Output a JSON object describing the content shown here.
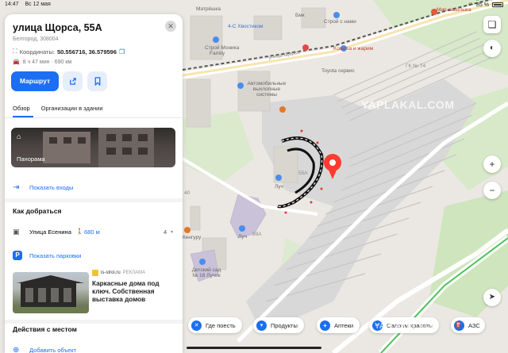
{
  "status": {
    "time": "14:47",
    "date": "Вс 12 мая",
    "battery": "85 %"
  },
  "card": {
    "title": "улица Щорса, 55А",
    "subtitle": "Белгород, 308004",
    "coords_label": "Координаты:",
    "coords_value": "50.556716, 36.579596",
    "route_info": "8 ч 47 мин · 690 км",
    "route_button": "Маршрут",
    "tabs": [
      "Обзор",
      "Организации в здании"
    ],
    "panorama_label": "Панорама",
    "show_entrances": "Показать входы",
    "how_to_get": "Как добраться",
    "street": "Улица Есенина",
    "street_distance": "680 м",
    "street_count": "4",
    "show_parking": "Показать парковки",
    "ad_source": "is-stroi.ru",
    "ad_tag": "РЕКЛАМА",
    "ad_text": "Каркасные дома под ключ. Собственная выставка домов",
    "actions_title": "Действия с местом",
    "add_object": "Добавить объект"
  },
  "map_labels": {
    "matrix": "Матрёшка",
    "bmk": "Бмк",
    "stroi": "Строй с нами",
    "mir": "Мир шашлыка",
    "cs_khostikom": "4-С Хвостиком",
    "stroi_monika": "Строй Моника",
    "family": "Family",
    "street_name": "улица Щорса",
    "bukva": "Kolessa и жарим",
    "toyota": "Toyota сервис",
    "gk": "ГК № 74",
    "auto_systems": "Автомобильные выхлопные системы",
    "luch": "Луч",
    "kengur": "Кенгуру",
    "kindergarten": "Детский сад № 18 Лучик",
    "num_40": "40",
    "num_59a": "59А",
    "num_55a": "55А"
  },
  "chips": [
    "Где поесть",
    "Продукты",
    "Аптеки",
    "Салоны красоты",
    "АЗС"
  ],
  "watermark": "YAPLAKAL.COM",
  "accent": "#1c6ef2",
  "pin_color": "#ff3b30"
}
